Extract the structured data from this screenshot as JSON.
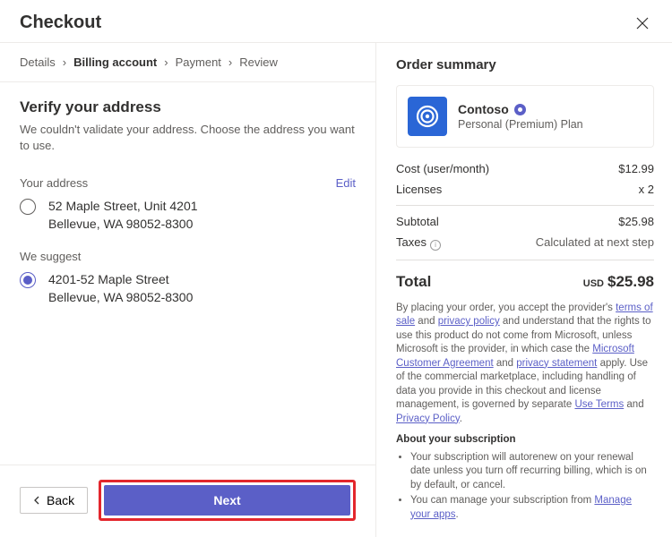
{
  "header": {
    "title": "Checkout"
  },
  "breadcrumb": {
    "items": [
      "Details",
      "Billing account",
      "Payment",
      "Review"
    ],
    "activeIndex": 1
  },
  "verify": {
    "heading": "Verify your address",
    "subtext": "We couldn't validate your address. Choose the address you want to use.",
    "your_address_label": "Your address",
    "edit_label": "Edit",
    "we_suggest_label": "We suggest",
    "options": [
      {
        "line1": "52 Maple Street, Unit 4201",
        "line2": "Bellevue, WA 98052-8300",
        "selected": false
      },
      {
        "line1": "4201-52 Maple Street",
        "line2": "Bellevue, WA 98052-8300",
        "selected": true
      }
    ]
  },
  "footer": {
    "back_label": "Back",
    "next_label": "Next"
  },
  "summary": {
    "title": "Order summary",
    "product_name": "Contoso",
    "plan_name": "Personal (Premium) Plan",
    "cost_label": "Cost  (user/month)",
    "cost_value": "$12.99",
    "licenses_label": "Licenses",
    "licenses_value": "x 2",
    "subtotal_label": "Subtotal",
    "subtotal_value": "$25.98",
    "taxes_label": "Taxes",
    "taxes_value": "Calculated at next step",
    "total_label": "Total",
    "total_currency": "USD",
    "total_value": "$25.98"
  },
  "legal": {
    "p1a": "By placing your order, you accept the provider's ",
    "terms_of_sale": "terms of sale",
    "p1b": " and ",
    "privacy_policy": "privacy policy",
    "p1c": " and understand that the rights to use this product do not come from Microsoft, unless Microsoft is the provider, in which case the ",
    "mca": "Microsoft Customer Agreement",
    "p1d": " and ",
    "privacy_statement": "privacy statement",
    "p1e": " apply. Use of the commercial marketplace, including handling of data you provide in this checkout and license management, is governed by separate ",
    "use_terms": "Use Terms",
    "p1f": " and ",
    "privacy_policy2": "Privacy Policy",
    "p1g": ".",
    "about_heading": "About your subscription",
    "bullet1": "Your subscription will autorenew on your renewal date unless you turn off recurring billing, which is on by default, or cancel.",
    "bullet2a": "You can manage your subscription from ",
    "manage_link": "Manage your apps",
    "bullet2b": "."
  }
}
